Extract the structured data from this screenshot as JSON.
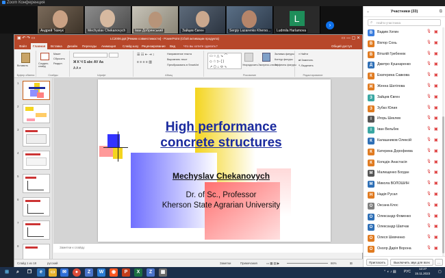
{
  "zoom": {
    "window_title": "Zoom Конференция"
  },
  "gallery": [
    {
      "name": "Андрей Ткачук"
    },
    {
      "name": "Mechyslav Chekanovych"
    },
    {
      "name": "Іван Добрянський"
    },
    {
      "name": "Зайцев Євген"
    },
    {
      "name": "Sergiy Lazarenko Kherso..."
    },
    {
      "name": "Ludmila Harlamova",
      "initial": "L"
    }
  ],
  "gallery_next": "›",
  "ppt": {
    "title": "LC2006.ppt [Режим совместимости] - PowerPoint (Сбой активации продукта)",
    "search": "Что вы хотите сделать?",
    "tabs": [
      "Файл",
      "Главная",
      "Вставка",
      "Дизайн",
      "Переходы",
      "Анимация",
      "Слайд-шоу",
      "Рецензирование",
      "Вид"
    ],
    "account": "Общий доступ",
    "ribbon": {
      "paste": "Вставить",
      "create_slide": "Создать слайд",
      "layout": "Макет",
      "reset": "Сбросить",
      "section": "Раздел",
      "g_clipboard": "Буфер обмена",
      "g_slides": "Слайды",
      "g_font": "Шрифт",
      "g_paragraph": "Абзац",
      "g_drawing": "Рисование",
      "g_editing": "Редактирование",
      "text_dir": "Направление текста",
      "align_text": "Выровнять текст",
      "smartart": "Преобразовать в SmartArt",
      "arrange": "Упорядочить",
      "quick_styles": "Экспресс-стили",
      "fill": "Заливка фигуры",
      "outline": "Контур фигуры",
      "effects": "Эффекты фигуры",
      "find": "Найти",
      "replace": "Заменить",
      "select": "Выделить"
    },
    "thumb_numbers": [
      "1",
      "2",
      "3",
      "4",
      "5",
      "6",
      "7",
      "8"
    ],
    "slide": {
      "title_line1": "High performance",
      "title_line2": "concrete structures",
      "author": "Mechyslav Chekanovych",
      "subtitle_line1": "Dr. of Sc., Professor",
      "subtitle_line2": "Kherson State Agrarian University"
    },
    "notes_placeholder": "Заметки к слайду",
    "status": {
      "slide_info": "Слайд 1 из 18",
      "language": "русский",
      "notes_btn": "Заметки",
      "comments_btn": "Примечания",
      "zoom": "66%"
    }
  },
  "participants": {
    "title": "Участники (33)",
    "search_placeholder": "Найти участника",
    "list": [
      {
        "initial": "В",
        "name": "Вадим Хегин",
        "color": "#3b7ddd"
      },
      {
        "initial": "В",
        "name": "Віктор Сонь",
        "color": "#e07b21"
      },
      {
        "initial": "В",
        "name": "Віталій Гребенюк",
        "color": "#e07b21"
      },
      {
        "initial": "Д",
        "name": "Дмитро Кушнаренко",
        "color": "#2e6fb6"
      },
      {
        "initial": "К",
        "name": "Екатерина Савкова",
        "color": "#e07b21"
      },
      {
        "initial": "Ж",
        "name": "Женна Шатілова",
        "color": "#e07b21"
      },
      {
        "initial": "З",
        "name": "Зайцев Євген",
        "color": "#3aa7a3"
      },
      {
        "initial": "З",
        "name": "Зубко Юлия",
        "color": "#e07b21"
      },
      {
        "initial": "І",
        "name": "Игорь Шеклев",
        "color": "#555555"
      },
      {
        "initial": "І",
        "name": "Іван Вельбек",
        "color": "#3aa7a3"
      },
      {
        "initial": "К",
        "name": "Калашников Олексій",
        "color": "#2e6fb6"
      },
      {
        "initial": "К",
        "name": "Катерина Дорофеева",
        "color": "#e07b21"
      },
      {
        "initial": "К",
        "name": "Колєдін Анастасія",
        "color": "#e07b21"
      },
      {
        "initial": "М",
        "name": "Малищенко Богдан",
        "color": "#555555"
      },
      {
        "initial": "М",
        "name": "Микола ВОЛОШИН",
        "color": "#2e6fb6"
      },
      {
        "initial": "Н",
        "name": "Надія Русал",
        "color": "#e07b21"
      },
      {
        "initial": "О",
        "name": "Оксана Клос",
        "color": "#7f7f7f"
      },
      {
        "initial": "О",
        "name": "Олександр Фоменко",
        "color": "#2e6fb6"
      },
      {
        "initial": "О",
        "name": "Олександр Шапчак",
        "color": "#2e6fb6"
      },
      {
        "initial": "О",
        "name": "Олеся Шевченко",
        "color": "#e07b21"
      },
      {
        "initial": "О",
        "name": "Онолр Дарія Ворона",
        "color": "#e07b21"
      }
    ],
    "invite": "Пригласить",
    "mute_all": "Выключить звук для всех"
  },
  "taskbar": {
    "time": "12:27",
    "date": "15.11.2023",
    "lang": "РУС"
  }
}
